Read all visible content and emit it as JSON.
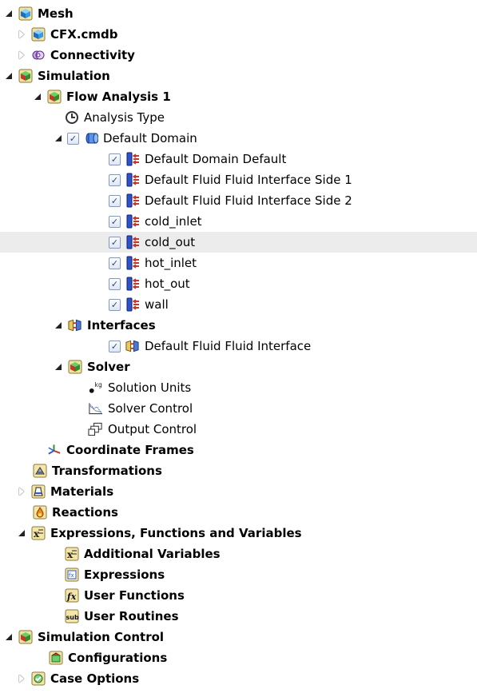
{
  "tree": {
    "items": [
      {
        "label": "Mesh",
        "bold": true,
        "icon": "mesh-icon",
        "expander": "open",
        "checkbox": false
      },
      {
        "label": "CFX.cmdb",
        "bold": true,
        "icon": "mesh-file-icon",
        "expander": "closed",
        "checkbox": false
      },
      {
        "label": "Connectivity",
        "bold": true,
        "icon": "connectivity-icon",
        "expander": "closed",
        "checkbox": false
      },
      {
        "label": "Simulation",
        "bold": true,
        "icon": "simulation-icon",
        "expander": "open",
        "checkbox": false
      },
      {
        "label": "Flow Analysis 1",
        "bold": true,
        "icon": "flow-analysis-icon",
        "expander": "open",
        "checkbox": false
      },
      {
        "label": "Analysis Type",
        "bold": false,
        "icon": "clock-icon",
        "expander": "none",
        "checkbox": false
      },
      {
        "label": "Default Domain",
        "bold": false,
        "icon": "domain-icon",
        "expander": "open",
        "checkbox": true
      },
      {
        "label": "Default Domain Default",
        "bold": false,
        "icon": "boundary-icon",
        "expander": "none",
        "checkbox": true
      },
      {
        "label": "Default Fluid Fluid Interface Side 1",
        "bold": false,
        "icon": "boundary-icon",
        "expander": "none",
        "checkbox": true
      },
      {
        "label": "Default Fluid Fluid Interface Side 2",
        "bold": false,
        "icon": "boundary-icon",
        "expander": "none",
        "checkbox": true
      },
      {
        "label": "cold_inlet",
        "bold": false,
        "icon": "boundary-icon",
        "expander": "none",
        "checkbox": true
      },
      {
        "label": "cold_out",
        "bold": false,
        "icon": "boundary-icon",
        "expander": "none",
        "checkbox": true,
        "highlight": true
      },
      {
        "label": "hot_inlet",
        "bold": false,
        "icon": "boundary-icon",
        "expander": "none",
        "checkbox": true
      },
      {
        "label": "hot_out",
        "bold": false,
        "icon": "boundary-icon",
        "expander": "none",
        "checkbox": true
      },
      {
        "label": "wall",
        "bold": false,
        "icon": "boundary-icon",
        "expander": "none",
        "checkbox": true
      },
      {
        "label": "Interfaces",
        "bold": true,
        "icon": "interfaces-icon",
        "expander": "open",
        "checkbox": false
      },
      {
        "label": "Default Fluid Fluid Interface",
        "bold": false,
        "icon": "interfaces-icon",
        "expander": "none",
        "checkbox": true
      },
      {
        "label": "Solver",
        "bold": true,
        "icon": "solver-icon",
        "expander": "open",
        "checkbox": false
      },
      {
        "label": "Solution Units",
        "bold": false,
        "icon": "units-icon",
        "expander": "none",
        "checkbox": false
      },
      {
        "label": "Solver Control",
        "bold": false,
        "icon": "solver-control-icon",
        "expander": "none",
        "checkbox": false
      },
      {
        "label": "Output Control",
        "bold": false,
        "icon": "output-control-icon",
        "expander": "none",
        "checkbox": false
      },
      {
        "label": "Coordinate Frames",
        "bold": true,
        "icon": "coordinate-frames-icon",
        "expander": "none",
        "checkbox": false
      },
      {
        "label": "Transformations",
        "bold": true,
        "icon": "transformations-icon",
        "expander": "none",
        "checkbox": false
      },
      {
        "label": "Materials",
        "bold": true,
        "icon": "materials-icon",
        "expander": "closed",
        "checkbox": false
      },
      {
        "label": "Reactions",
        "bold": true,
        "icon": "reactions-icon",
        "expander": "none",
        "checkbox": false
      },
      {
        "label": "Expressions, Functions and Variables",
        "bold": true,
        "icon": "expressions-folder-icon",
        "expander": "open",
        "checkbox": false
      },
      {
        "label": "Additional Variables",
        "bold": true,
        "icon": "additional-variables-icon",
        "expander": "none",
        "checkbox": false
      },
      {
        "label": "Expressions",
        "bold": true,
        "icon": "expressions-icon",
        "expander": "none",
        "checkbox": false
      },
      {
        "label": "User Functions",
        "bold": true,
        "icon": "user-functions-icon",
        "expander": "none",
        "checkbox": false
      },
      {
        "label": "User Routines",
        "bold": true,
        "icon": "user-routines-icon",
        "expander": "none",
        "checkbox": false
      },
      {
        "label": "Simulation Control",
        "bold": true,
        "icon": "simulation-control-icon",
        "expander": "open",
        "checkbox": false
      },
      {
        "label": "Configurations",
        "bold": true,
        "icon": "configurations-icon",
        "expander": "none",
        "checkbox": false
      },
      {
        "label": "Case Options",
        "bold": true,
        "icon": "case-options-icon",
        "expander": "closed",
        "checkbox": false
      }
    ],
    "glyphs": {
      "solution_units_sup": "kg",
      "user_routines_text": "sub",
      "user_functions_text": "fx"
    }
  }
}
